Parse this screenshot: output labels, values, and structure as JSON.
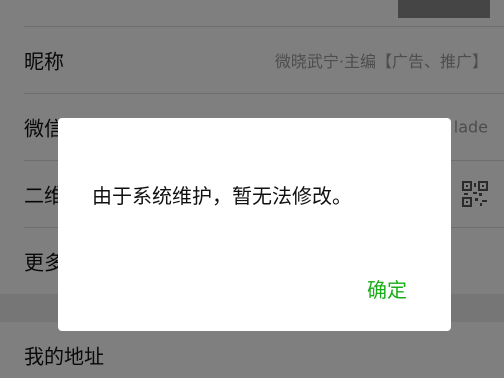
{
  "profile_rows": {
    "nickname": {
      "label": "昵称",
      "value": "微晓武宁·主编【广告、推广】"
    },
    "wechat_id": {
      "label": "微信号",
      "value": "lade"
    },
    "qr_code": {
      "label": "二维码"
    },
    "more": {
      "label": "更多"
    }
  },
  "address_row": {
    "label": "我的地址"
  },
  "dialog": {
    "message": "由于系统维护，暂无法修改。",
    "confirm_label": "确定"
  },
  "colors": {
    "accent": "#1aad19",
    "overlay": "rgba(0,0,0,0.5)"
  }
}
